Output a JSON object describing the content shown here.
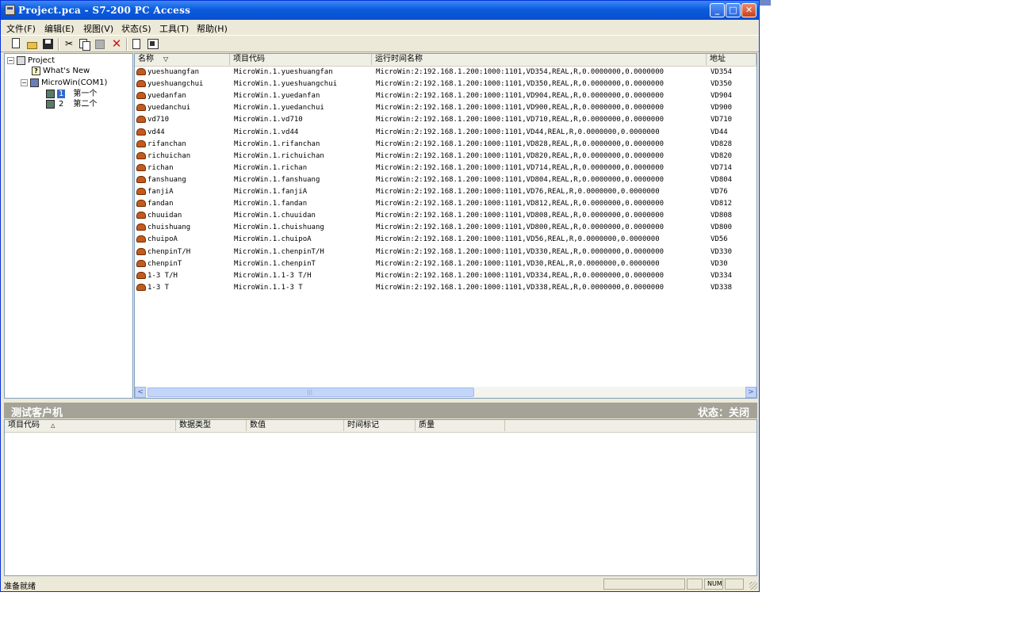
{
  "window": {
    "title": "Project.pca - S7-200 PC Access",
    "min_label": "_",
    "max_label": "□",
    "close_label": "✕"
  },
  "menu": [
    {
      "label": "文件(F)"
    },
    {
      "label": "编辑(E)"
    },
    {
      "label": "视图(V)"
    },
    {
      "label": "状态(S)"
    },
    {
      "label": "工具(T)"
    },
    {
      "label": "帮助(H)"
    }
  ],
  "toolbar": {
    "cut_glyph": "✂",
    "delete_glyph": "✕"
  },
  "tree": {
    "root_expander": "−",
    "root": "Project",
    "whats_new_icon": "?",
    "whats_new": "What's New",
    "plc_expander": "−",
    "plc": "MicroWin(COM1)",
    "folder1_num": "1",
    "folder1_name": "第一个",
    "folder2_num": "2",
    "folder2_name": "第二个"
  },
  "list": {
    "headers": {
      "name": "名称",
      "sort_icon": "▽",
      "item_code": "项目代码",
      "runtime_name": "运行时间名称",
      "address": "地址"
    },
    "rows": [
      {
        "name": "yueshuangfan",
        "code": "MicroWin.1.yueshuangfan",
        "runtime": "MicroWin:2:192.168.1.200:1000:1101,VD354,REAL,R,0.0000000,0.0000000",
        "address": "VD354"
      },
      {
        "name": "yueshuangchui",
        "code": "MicroWin.1.yueshuangchui",
        "runtime": "MicroWin:2:192.168.1.200:1000:1101,VD350,REAL,R,0.0000000,0.0000000",
        "address": "VD350"
      },
      {
        "name": "yuedanfan",
        "code": "MicroWin.1.yuedanfan",
        "runtime": "MicroWin:2:192.168.1.200:1000:1101,VD904,REAL,R,0.0000000,0.0000000",
        "address": "VD904"
      },
      {
        "name": "yuedanchui",
        "code": "MicroWin.1.yuedanchui",
        "runtime": "MicroWin:2:192.168.1.200:1000:1101,VD900,REAL,R,0.0000000,0.0000000",
        "address": "VD900"
      },
      {
        "name": "vd710",
        "code": "MicroWin.1.vd710",
        "runtime": "MicroWin:2:192.168.1.200:1000:1101,VD710,REAL,R,0.0000000,0.0000000",
        "address": "VD710"
      },
      {
        "name": "vd44",
        "code": "MicroWin.1.vd44",
        "runtime": "MicroWin:2:192.168.1.200:1000:1101,VD44,REAL,R,0.0000000,0.0000000",
        "address": "VD44"
      },
      {
        "name": "rifanchan",
        "code": "MicroWin.1.rifanchan",
        "runtime": "MicroWin:2:192.168.1.200:1000:1101,VD828,REAL,R,0.0000000,0.0000000",
        "address": "VD828"
      },
      {
        "name": "richuichan",
        "code": "MicroWin.1.richuichan",
        "runtime": "MicroWin:2:192.168.1.200:1000:1101,VD820,REAL,R,0.0000000,0.0000000",
        "address": "VD820"
      },
      {
        "name": "richan",
        "code": "MicroWin.1.richan",
        "runtime": "MicroWin:2:192.168.1.200:1000:1101,VD714,REAL,R,0.0000000,0.0000000",
        "address": "VD714"
      },
      {
        "name": "fanshuang",
        "code": "MicroWin.1.fanshuang",
        "runtime": "MicroWin:2:192.168.1.200:1000:1101,VD804,REAL,R,0.0000000,0.0000000",
        "address": "VD804"
      },
      {
        "name": "fanjiA",
        "code": "MicroWin.1.fanjiA",
        "runtime": "MicroWin:2:192.168.1.200:1000:1101,VD76,REAL,R,0.0000000,0.0000000",
        "address": "VD76"
      },
      {
        "name": "fandan",
        "code": "MicroWin.1.fandan",
        "runtime": "MicroWin:2:192.168.1.200:1000:1101,VD812,REAL,R,0.0000000,0.0000000",
        "address": "VD812"
      },
      {
        "name": "chuuidan",
        "code": "MicroWin.1.chuuidan",
        "runtime": "MicroWin:2:192.168.1.200:1000:1101,VD808,REAL,R,0.0000000,0.0000000",
        "address": "VD808"
      },
      {
        "name": "chuishuang",
        "code": "MicroWin.1.chuishuang",
        "runtime": "MicroWin:2:192.168.1.200:1000:1101,VD800,REAL,R,0.0000000,0.0000000",
        "address": "VD800"
      },
      {
        "name": "chuipoA",
        "code": "MicroWin.1.chuipoA",
        "runtime": "MicroWin:2:192.168.1.200:1000:1101,VD56,REAL,R,0.0000000,0.0000000",
        "address": "VD56"
      },
      {
        "name": "chenpinT/H",
        "code": "MicroWin.1.chenpinT/H",
        "runtime": "MicroWin:2:192.168.1.200:1000:1101,VD330,REAL,R,0.0000000,0.0000000",
        "address": "VD330"
      },
      {
        "name": "chenpinT",
        "code": "MicroWin.1.chenpinT",
        "runtime": "MicroWin:2:192.168.1.200:1000:1101,VD30,REAL,R,0.0000000,0.0000000",
        "address": "VD30"
      },
      {
        "name": "1-3 T/H",
        "code": "MicroWin.1.1-3 T/H",
        "runtime": "MicroWin:2:192.168.1.200:1000:1101,VD334,REAL,R,0.0000000,0.0000000",
        "address": "VD334"
      },
      {
        "name": "1-3 T",
        "code": "MicroWin.1.1-3 T",
        "runtime": "MicroWin:2:192.168.1.200:1000:1101,VD338,REAL,R,0.0000000,0.0000000",
        "address": "VD338"
      }
    ],
    "scroll_left": "<",
    "scroll_right": ">",
    "scroll_grip": "|||"
  },
  "test_client": {
    "title": "测试客户机",
    "status": "状态：关闭",
    "headers": {
      "item_code": "项目代码",
      "sort_icon": "△",
      "data_type": "数据类型",
      "value": "数值",
      "timestamp": "时间标记",
      "quality": "质量"
    }
  },
  "statusbar": {
    "text": "准备就绪",
    "num": "NUM"
  }
}
